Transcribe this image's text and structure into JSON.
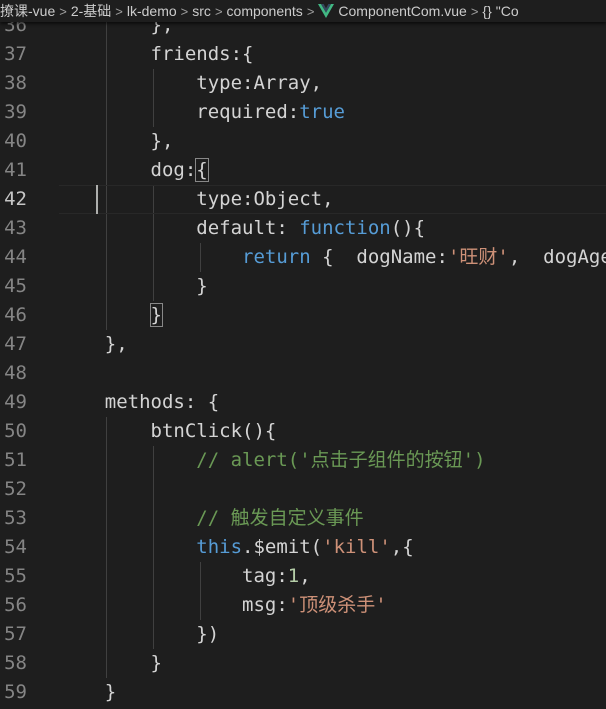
{
  "breadcrumb": {
    "items": [
      {
        "label": "撩课-vue"
      },
      {
        "label": "2-基础"
      },
      {
        "label": "lk-demo"
      },
      {
        "label": "src"
      },
      {
        "label": "components"
      },
      {
        "label": "ComponentCom.vue"
      },
      {
        "label": "\"Co"
      }
    ],
    "separator": ">",
    "braces": "{}"
  },
  "colors": {
    "background": "#1e1e1e",
    "keyword": "#569cd6",
    "string": "#ce9178",
    "comment": "#6a9955",
    "number": "#b5cea8",
    "text": "#d4d4d4",
    "line_number": "#858585",
    "vue_green": "#41b883"
  },
  "editor": {
    "current_line": "42",
    "lines": [
      {
        "num": "36",
        "tokens": [
          {
            "t": "        },",
            "c": "p"
          }
        ]
      },
      {
        "num": "37",
        "tokens": [
          {
            "t": "        friends:{",
            "c": "p"
          }
        ]
      },
      {
        "num": "38",
        "tokens": [
          {
            "t": "            type:Array,",
            "c": "p"
          }
        ]
      },
      {
        "num": "39",
        "tokens": [
          {
            "t": "            required:",
            "c": "p"
          },
          {
            "t": "true",
            "c": "k"
          }
        ]
      },
      {
        "num": "40",
        "tokens": [
          {
            "t": "        },",
            "c": "p"
          }
        ]
      },
      {
        "num": "41",
        "tokens": [
          {
            "t": "        dog:",
            "c": "p"
          },
          {
            "t": "{",
            "c": "p",
            "box": true
          }
        ]
      },
      {
        "num": "42",
        "tokens": [
          {
            "t": "            type:Object,",
            "c": "p"
          }
        ]
      },
      {
        "num": "43",
        "tokens": [
          {
            "t": "            default: ",
            "c": "p"
          },
          {
            "t": "function",
            "c": "k"
          },
          {
            "t": "(){",
            "c": "p"
          }
        ]
      },
      {
        "num": "44",
        "tokens": [
          {
            "t": "                ",
            "c": "p"
          },
          {
            "t": "return",
            "c": "k"
          },
          {
            "t": " {  dogName:",
            "c": "p"
          },
          {
            "t": "'旺财'",
            "c": "s"
          },
          {
            "t": ",  dogAge",
            "c": "p"
          }
        ]
      },
      {
        "num": "45",
        "tokens": [
          {
            "t": "            }",
            "c": "p"
          }
        ]
      },
      {
        "num": "46",
        "tokens": [
          {
            "t": "        ",
            "c": "p"
          },
          {
            "t": "}",
            "c": "p",
            "box": true
          }
        ]
      },
      {
        "num": "47",
        "tokens": [
          {
            "t": "    },",
            "c": "p"
          }
        ]
      },
      {
        "num": "48",
        "tokens": []
      },
      {
        "num": "49",
        "tokens": [
          {
            "t": "    methods: {",
            "c": "p"
          }
        ]
      },
      {
        "num": "50",
        "tokens": [
          {
            "t": "        btnClick(){",
            "c": "p"
          }
        ]
      },
      {
        "num": "51",
        "tokens": [
          {
            "t": "            ",
            "c": "p"
          },
          {
            "t": "// alert('点击子组件的按钮')",
            "c": "c"
          }
        ]
      },
      {
        "num": "52",
        "tokens": []
      },
      {
        "num": "53",
        "tokens": [
          {
            "t": "            ",
            "c": "p"
          },
          {
            "t": "// 触发自定义事件",
            "c": "c"
          }
        ]
      },
      {
        "num": "54",
        "tokens": [
          {
            "t": "            ",
            "c": "p"
          },
          {
            "t": "this",
            "c": "k"
          },
          {
            "t": ".$emit(",
            "c": "p"
          },
          {
            "t": "'kill'",
            "c": "s"
          },
          {
            "t": ",{",
            "c": "p"
          }
        ]
      },
      {
        "num": "55",
        "tokens": [
          {
            "t": "                tag:",
            "c": "p"
          },
          {
            "t": "1",
            "c": "n"
          },
          {
            "t": ",",
            "c": "p"
          }
        ]
      },
      {
        "num": "56",
        "tokens": [
          {
            "t": "                msg:",
            "c": "p"
          },
          {
            "t": "'顶级杀手'",
            "c": "s"
          }
        ]
      },
      {
        "num": "57",
        "tokens": [
          {
            "t": "            })",
            "c": "p"
          }
        ]
      },
      {
        "num": "58",
        "tokens": [
          {
            "t": "        }",
            "c": "p"
          }
        ]
      },
      {
        "num": "59",
        "tokens": [
          {
            "t": "    }",
            "c": "p"
          }
        ]
      }
    ]
  }
}
